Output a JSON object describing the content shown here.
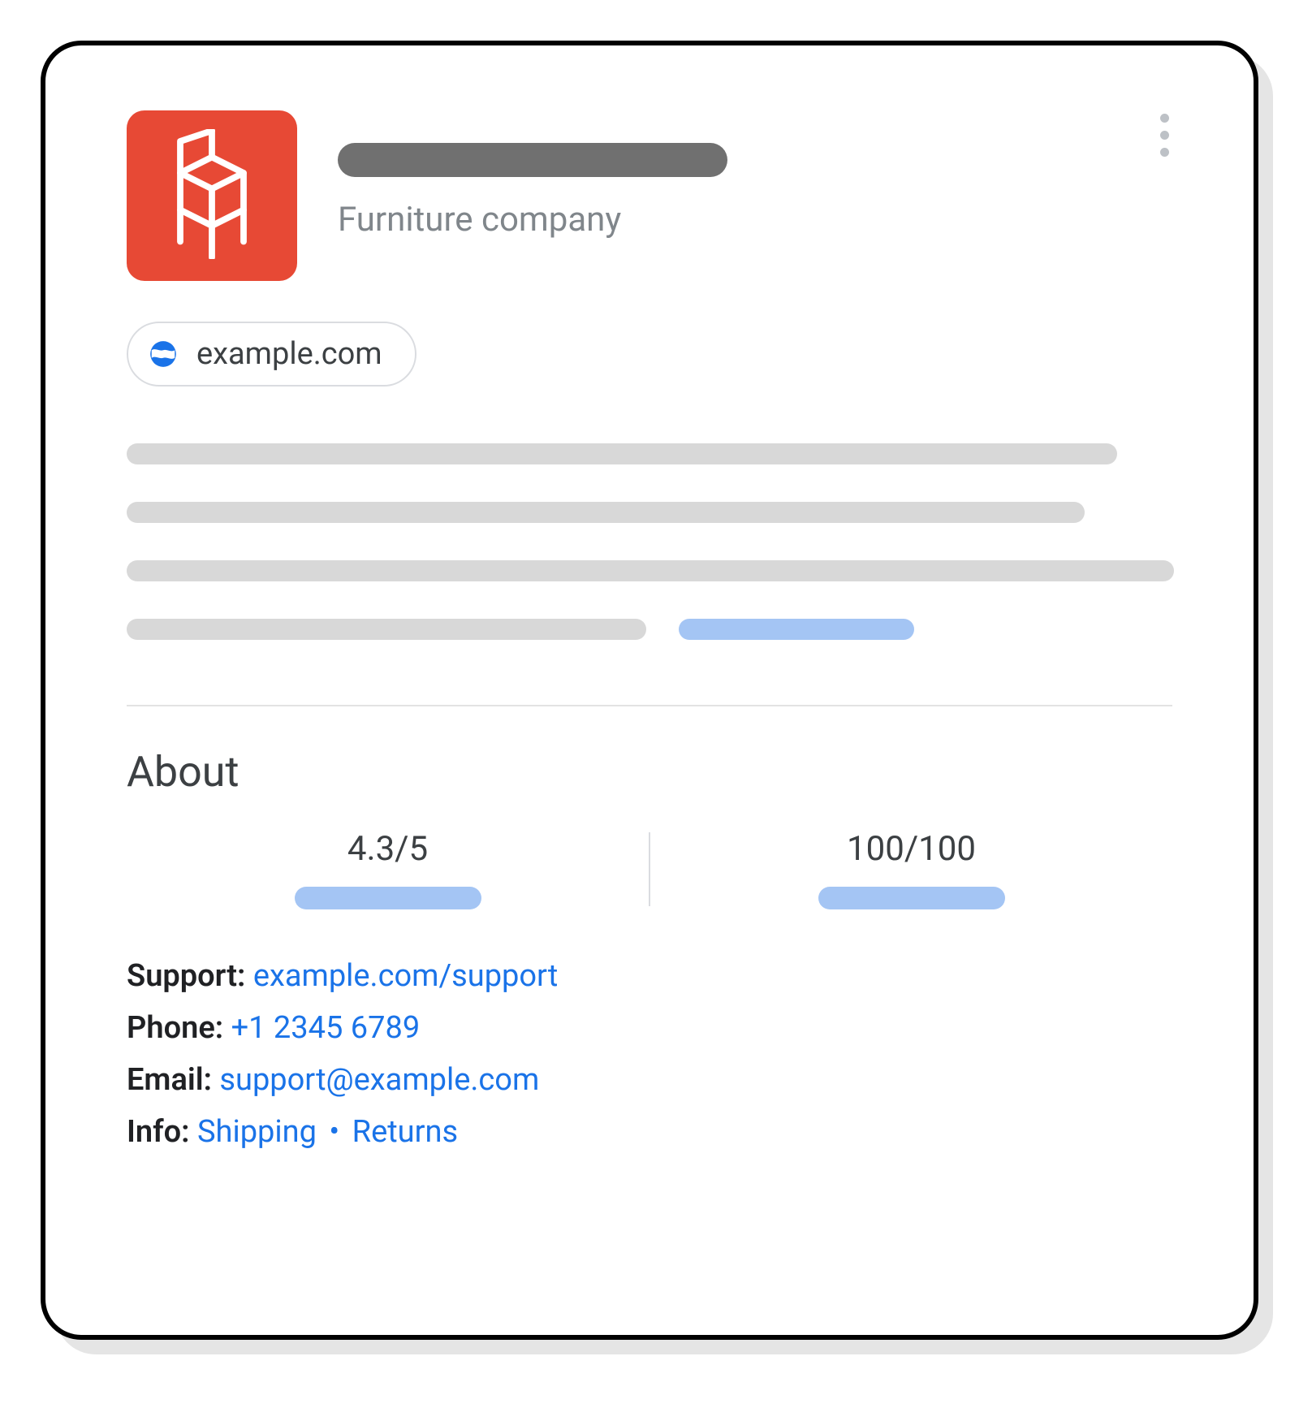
{
  "header": {
    "subtitle": "Furniture company"
  },
  "website": {
    "label": "example.com"
  },
  "about": {
    "heading": "About",
    "rating": "4.3/5",
    "score": "100/100"
  },
  "contact": {
    "support_label": "Support:",
    "support_value": "example.com/support",
    "phone_label": "Phone:",
    "phone_value": "+1 2345 6789",
    "email_label": "Email:",
    "email_value": "support@example.com",
    "info_label": "Info:",
    "info_shipping": "Shipping",
    "info_returns": "Returns",
    "info_separator": "•"
  }
}
